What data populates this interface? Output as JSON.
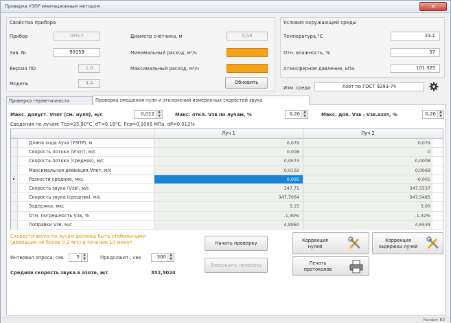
{
  "window": {
    "title": "Проверка УЗПР имитационным методом",
    "close_label": "✕"
  },
  "device": {
    "group_title": "Свойства прибора",
    "device_label": "Прибор",
    "device_value": "UFG.F",
    "serial_label": "Зав. №",
    "serial_value": "90159",
    "fw_label": "Версия ПО",
    "fw_value": "1.0",
    "model_label": "Модель",
    "model_value": "4.4",
    "diameter_label": "Диаметр счётчика, м",
    "diameter_value": "0,08",
    "min_flow_label": "Минимальный расход, м³/ч",
    "max_flow_label": "Максимальный расход, м³/ч",
    "update_button": "Обновить"
  },
  "env": {
    "group_title": "Условия окружающей среды",
    "temp_label": "Температура,°C",
    "temp_value": "23.1",
    "humidity_label": "Отн. влажность, %",
    "humidity_value": "57",
    "pressure_label": "Атмосферное давление, кПа",
    "pressure_value": "101.325",
    "medium_label": "Изм. среда",
    "medium_value": "Азот по ГОСТ 9293-74"
  },
  "tabs": [
    {
      "label": "Проверка герметичности"
    },
    {
      "label": "Проверка смещения нуля и отклонений измеренных скоростей звука"
    }
  ],
  "params": {
    "max_zero_label": "Макс. допуст. Vпот (см. нуля), м/с",
    "max_zero_value": "0,012",
    "max_dev_label": "Макс. откл. Vзв по лучам, %",
    "max_dev_value": "0,20",
    "max_dev_nitro_label": "Макс. доп. Vзв - Vзв.азот, %",
    "max_dev_nitro_value": "0,20",
    "rays_info": "Сведения по лучам: Тср=25,90°C, dT=0,18°C, Рср=0,1005 МПа, dP=0,013%"
  },
  "grid": {
    "columns": [
      "Луч 1",
      "Луч 2"
    ],
    "rows": [
      {
        "name": "Длина хода луча (УЗПР), м",
        "v1": "0,079",
        "v2": "0,079"
      },
      {
        "name": "Скорость потока (Vпот), м/с",
        "v1": "0,008",
        "v2": "0"
      },
      {
        "name": "Скорость потока (средняя), м/с",
        "v1": "0,0073",
        "v2": "-0,0008"
      },
      {
        "name": "Максимальная девиация Vпот, м/с",
        "v1": "0,0102",
        "v2": "0,0069"
      },
      {
        "name": "Разности средние, мкс",
        "v1": "0,005",
        "v2": "-0,001",
        "marker": "▸"
      },
      {
        "name": "Скорость звука (Vзв), м/с",
        "v1": "347,71",
        "v2": "347,5537"
      },
      {
        "name": "Скорость звука (средняя), м/с",
        "v1": "347,7064",
        "v2": "347,5485"
      },
      {
        "name": "Задержка, мкс",
        "v1": "3,15",
        "v2": "3,00"
      },
      {
        "name": "Отн. погрешность Vзв, %",
        "v1": "-1,39%",
        "v2": "-1,32%"
      },
      {
        "name": "Поправки Vзв, м/с",
        "v1": "4,8960",
        "v2": "4,6539"
      }
    ]
  },
  "bottom": {
    "warning": "Скорости звука по лучам должны быть стабильными (девиация не более 0,2 м/с) в течение 10 минут",
    "interval_label": "Интервал опроса, сек",
    "interval_value": "5",
    "duration_label": "Продолжит., сек",
    "duration_value": "300",
    "avg_label": "Средняя скорость звука в азоте, м/с",
    "avg_value": "352,5024",
    "start_button": "Начать проверку",
    "finish_button": "Завершить проверку",
    "zero_corr_button": "Коррекция нулей",
    "delay_corr_button": "Коррекция задержки лучей",
    "print_button": "Печать протоколов"
  },
  "status": {
    "text": "Конфиг ВЗ"
  },
  "colors": {
    "accent": "#1a86d6",
    "orange": "#f7a21b",
    "warning": "#f08a00"
  }
}
